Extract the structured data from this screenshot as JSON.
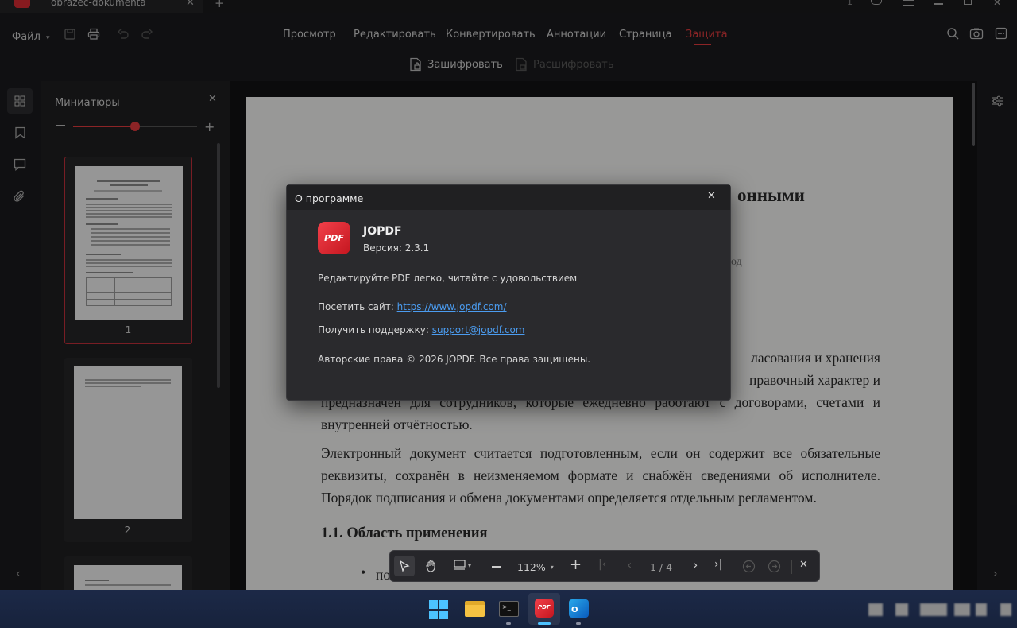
{
  "window": {
    "tab_title": "obrazec-dokumenta",
    "notification_count": "1"
  },
  "menu": {
    "file_label": "Файл",
    "nav": [
      "Просмотр",
      "Редактировать",
      "Конвертировать",
      "Аннотации",
      "Страница",
      "Защита"
    ],
    "active_nav": "Защита"
  },
  "ribbon": {
    "encrypt_label": "Зашифровать",
    "decrypt_label": "Расшифровать"
  },
  "thumbnails": {
    "title": "Миниатюры",
    "pages": [
      {
        "label": "1"
      },
      {
        "label": "2"
      }
    ],
    "zoom_fraction": 0.5
  },
  "document": {
    "heading_fragment": "онными",
    "subtitle_fragment": "од",
    "para1_frag": [
      "ласования и хранения",
      "правочный характер и"
    ],
    "para1_line3": "предназначен для сотрудников, которые ежедневно работают с договорами, счетами и",
    "para1_line4": "внутренней отчётностью.",
    "para2": [
      "Электронный документ считается подготовленным, если он содержит все обязательные",
      "реквизиты, сохранён в неизменяемом формате и снабжён сведениями об исполнителе.",
      "Порядок подписания и обмена документами определяется отдельным регламентом."
    ],
    "section_heading": "1.1. Область применения",
    "bullet_fragment": "по"
  },
  "about_dialog": {
    "title": "О программе",
    "app_name": "JOPDF",
    "logo_text": "PDF",
    "version": "Версия: 2.3.1",
    "tagline": "Редактируйте PDF легко, читайте с удовольствием",
    "site_label": "Посетить сайт:",
    "site_url": "https://www.jopdf.com/",
    "support_label": "Получить поддержку:",
    "support_email": "support@jopdf.com",
    "copyright": "Авторские права © 2026 JOPDF. Все права защищены."
  },
  "viewer_toolbar": {
    "zoom": "112%",
    "page_indicator": "1 / 4"
  },
  "colors": {
    "accent": "#e23a3e",
    "link": "#4b9cf0",
    "taskbar": "#1c2947"
  }
}
